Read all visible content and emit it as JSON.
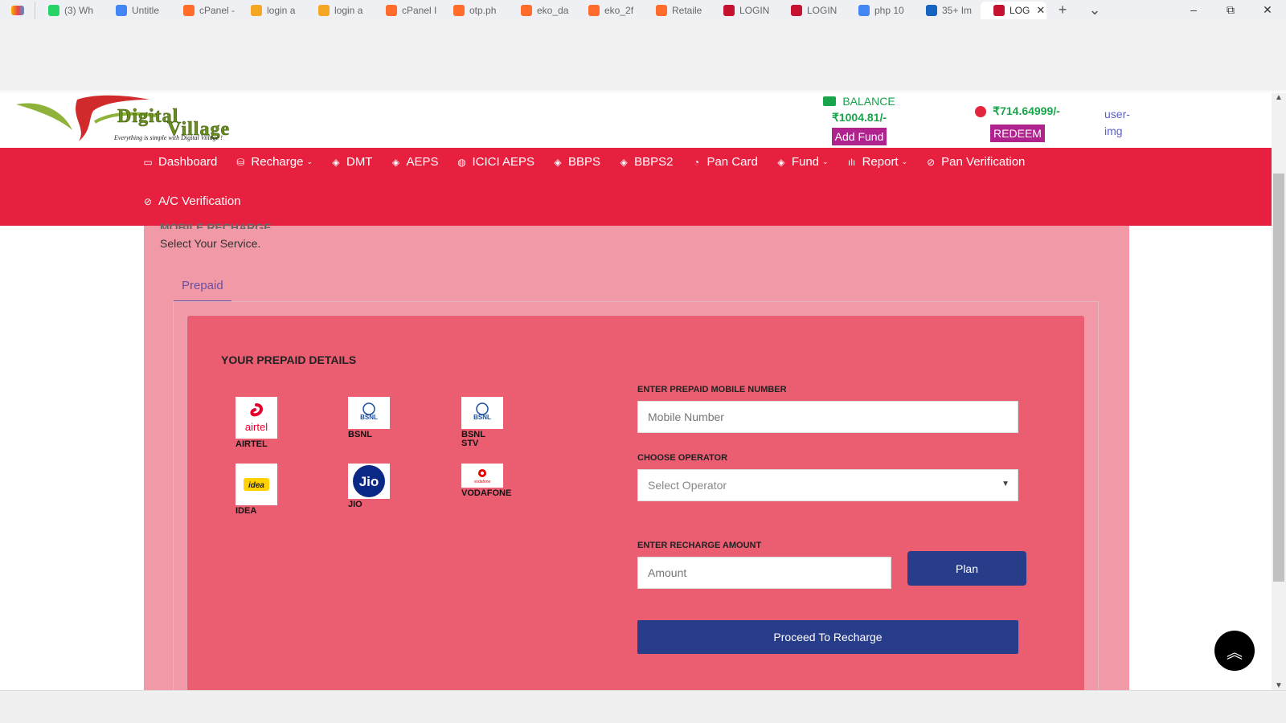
{
  "browser": {
    "tabs": [
      {
        "label": "(3) Wh",
        "color": "#25d366"
      },
      {
        "label": "Untitle",
        "color": "#4285f4"
      },
      {
        "label": "cPanel -",
        "color": "#ff6c2c"
      },
      {
        "label": "login a",
        "color": "#f5a623"
      },
      {
        "label": "login a",
        "color": "#f5a623"
      },
      {
        "label": "cPanel I",
        "color": "#ff6c2c"
      },
      {
        "label": "otp.ph",
        "color": "#ff6c2c"
      },
      {
        "label": "eko_da",
        "color": "#ff6c2c"
      },
      {
        "label": "eko_2f",
        "color": "#ff6c2c"
      },
      {
        "label": "Retaile",
        "color": "#ff6c2c"
      },
      {
        "label": "LOGIN",
        "color": "#c41230"
      },
      {
        "label": "LOGIN",
        "color": "#c41230"
      },
      {
        "label": "php 10",
        "color": "#4285f4"
      },
      {
        "label": "35+ Im",
        "color": "#1565c0"
      }
    ],
    "active_tab": {
      "label": "LOG",
      "close": "✕",
      "color": "#c41230"
    },
    "new_tab": "+",
    "tab_list": "⌄",
    "window_controls": {
      "minimize": "–",
      "restore": "⧉",
      "close": "✕"
    }
  },
  "header": {
    "logo_text": "Digital Village",
    "logo_tagline": "Everything is simple with Digital Village !",
    "balance_label": "BALANCE",
    "balance_value": "₹1004.81/-",
    "add_fund_label": "Add Fund",
    "redeem_value": "₹714.64999/-",
    "redeem_label": "REDEEM",
    "user_img_alt": "user-img"
  },
  "nav": {
    "row1": [
      {
        "label": "Dashboard",
        "icon": "▭",
        "caret": false
      },
      {
        "label": "Recharge",
        "icon": "⛁",
        "caret": true
      },
      {
        "label": "DMT",
        "icon": "◈",
        "caret": false
      },
      {
        "label": "AEPS",
        "icon": "◈",
        "caret": false
      },
      {
        "label": "ICICI AEPS",
        "icon": "◍",
        "caret": false
      },
      {
        "label": "BBPS",
        "icon": "◈",
        "caret": false
      },
      {
        "label": "BBPS2",
        "icon": "◈",
        "caret": false
      },
      {
        "label": "Pan Card",
        "icon": "◔",
        "caret": false
      },
      {
        "label": "Fund",
        "icon": "◈",
        "caret": true
      },
      {
        "label": "Report",
        "icon": "ılı",
        "caret": true
      },
      {
        "label": "Pan Verification",
        "icon": "⊘",
        "caret": false
      }
    ],
    "row2": [
      {
        "label": "A/C Verification",
        "icon": "⊘",
        "caret": false
      }
    ],
    "caret_glyph": "⌄"
  },
  "main": {
    "section_title": "MOBILE RECHARGE",
    "subtitle": "Select Your Service.",
    "tab_label": "Prepaid",
    "form_heading": "YOUR PREPAID DETAILS",
    "operators": [
      {
        "name": "AIRTEL",
        "logo": "airtel"
      },
      {
        "name": "BSNL",
        "logo": "BSNL"
      },
      {
        "name": "BSNL STV",
        "logo": "BSNL"
      },
      {
        "name": "IDEA",
        "logo": "idea"
      },
      {
        "name": "JIO",
        "logo": "Jio"
      },
      {
        "name": "VODAFONE",
        "logo": "vodafone"
      }
    ],
    "mobile_label": "ENTER PREPAID MOBILE NUMBER",
    "mobile_placeholder": "Mobile Number",
    "operator_label": "CHOOSE OPERATOR",
    "operator_selected": "Select Operator",
    "amount_label": "ENTER RECHARGE AMOUNT",
    "amount_placeholder": "Amount",
    "plan_label": "Plan",
    "proceed_label": "Proceed To Recharge"
  },
  "scroll_top_icon": "︽",
  "colors": {
    "nav_bg": "#e8203f",
    "form_bg": "#eb5e72",
    "button_bg": "#283d8a",
    "balance_green": "#19a34a",
    "badge_magenta": "#b0238f"
  }
}
